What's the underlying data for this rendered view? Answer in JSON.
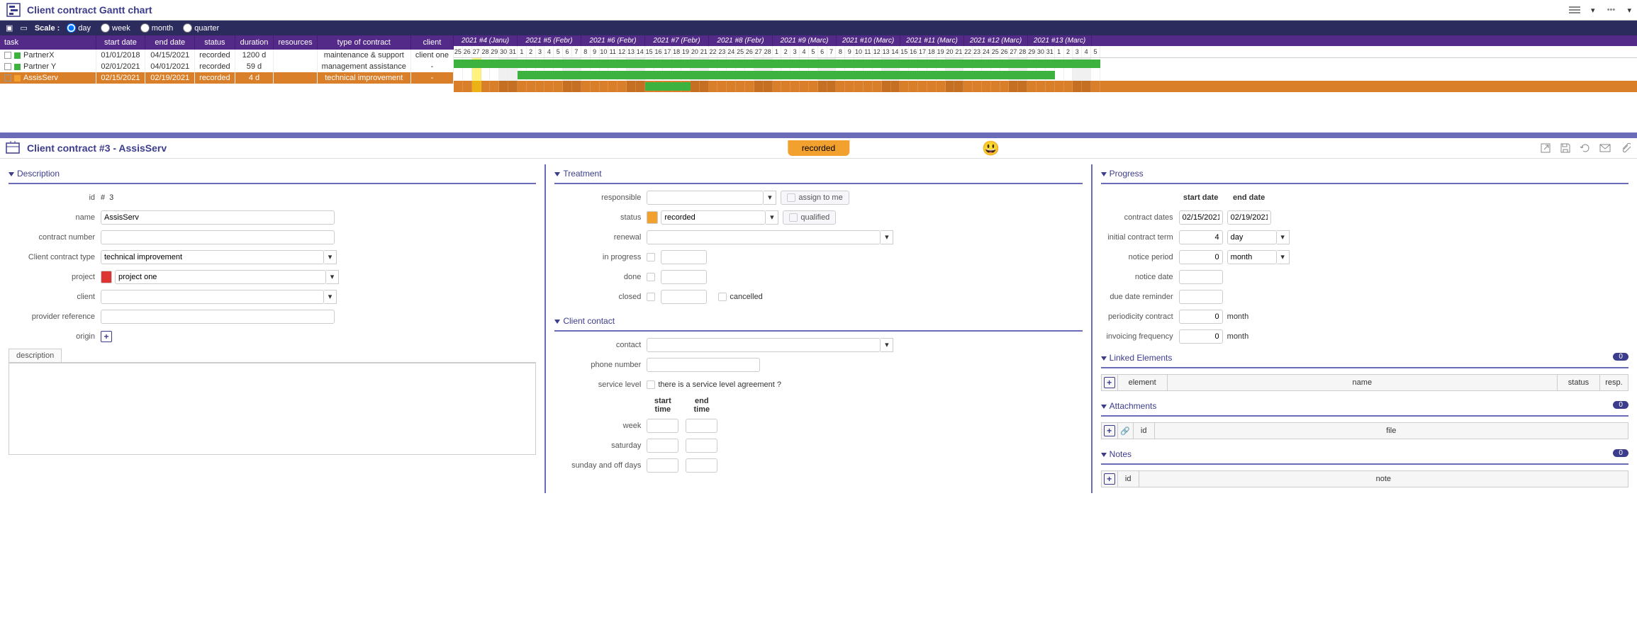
{
  "app": {
    "title": "Client contract Gantt chart"
  },
  "scale": {
    "label": "Scale :",
    "options": {
      "day": "day",
      "week": "week",
      "month": "month",
      "quarter": "quarter"
    },
    "selected": "day"
  },
  "grid": {
    "columns": {
      "task": "task",
      "start_date": "start date",
      "end_date": "end date",
      "status": "status",
      "duration": "duration",
      "resources": "resources",
      "type": "type of contract",
      "client": "client"
    },
    "rows": [
      {
        "task": "PartnerX",
        "start": "01/01/2018",
        "end": "04/15/2021",
        "status": "recorded",
        "duration": "1200 d",
        "resources": "",
        "type": "maintenance & support",
        "client": "client one",
        "color": "#3eb23e"
      },
      {
        "task": "Partner Y",
        "start": "02/01/2021",
        "end": "04/01/2021",
        "status": "recorded",
        "duration": "59 d",
        "resources": "",
        "type": "management assistance",
        "client": "-",
        "color": "#3eb23e"
      },
      {
        "task": "AssisServ",
        "start": "02/15/2021",
        "end": "02/19/2021",
        "status": "recorded",
        "duration": "4 d",
        "resources": "",
        "type": "technical improvement",
        "client": "-",
        "color": "#f2a02e",
        "selected": true
      }
    ]
  },
  "gantt": {
    "months": [
      "2021 #4 (Janu)",
      "2021 #5 (Febr)",
      "2021 #6 (Febr)",
      "2021 #7 (Febr)",
      "2021 #8 (Febr)",
      "2021 #9 (Marc)",
      "2021 #10 (Marc)",
      "2021 #11 (Marc)",
      "2021 #12 (Marc)",
      "2021 #13 (Marc)"
    ],
    "days": [
      25,
      26,
      27,
      28,
      29,
      30,
      31,
      1,
      2,
      3,
      4,
      5,
      6,
      7,
      8,
      9,
      10,
      11,
      12,
      13,
      14,
      15,
      16,
      17,
      18,
      19,
      20,
      21,
      22,
      23,
      24,
      25,
      26,
      27,
      28,
      1,
      2,
      3,
      4,
      5,
      6,
      7,
      8,
      9,
      10,
      11,
      12,
      13,
      14,
      15,
      16,
      17,
      18,
      19,
      20,
      21,
      22,
      23,
      24,
      25,
      26,
      27,
      28,
      29,
      30,
      31,
      1,
      2,
      3,
      4,
      5
    ]
  },
  "detail": {
    "title": "Client contract   #3  -  AssisServ",
    "status_pill": "recorded",
    "sections": {
      "description": "Description",
      "treatment": "Treatment",
      "client_contact": "Client contact",
      "progress": "Progress",
      "linked_elements": "Linked Elements",
      "attachments": "Attachments",
      "notes": "Notes"
    },
    "description": {
      "id_label": "id",
      "id_hash": "#",
      "id_value": "3",
      "name_label": "name",
      "name_value": "AssisServ",
      "contract_number_label": "contract number",
      "type_label": "Client contract type",
      "type_value": "technical improvement",
      "project_label": "project",
      "project_value": "project one",
      "client_label": "client",
      "provider_ref_label": "provider reference",
      "origin_label": "origin",
      "tab_description": "description"
    },
    "treatment": {
      "responsible_label": "responsible",
      "assign_to_me": "assign to me",
      "status_label": "status",
      "status_value": "recorded",
      "qualified": "qualified",
      "renewal_label": "renewal",
      "in_progress_label": "in progress",
      "done_label": "done",
      "closed_label": "closed",
      "cancelled_label": "cancelled"
    },
    "client_contact": {
      "contact_label": "contact",
      "phone_label": "phone number",
      "service_level_label": "service level",
      "sla_text": "there is a service level agreement ?",
      "start_time": "start time",
      "end_time": "end time",
      "week_label": "week",
      "saturday_label": "saturday",
      "sunday_label": "sunday and off days"
    },
    "progress": {
      "start_head": "start date",
      "end_head": "end date",
      "contract_dates_label": "contract dates",
      "start_value": "02/15/2021",
      "end_value": "02/19/2021",
      "initial_term_label": "initial contract term",
      "initial_term_value": "4",
      "initial_term_unit": "day",
      "notice_period_label": "notice period",
      "notice_period_value": "0",
      "notice_period_unit": "month",
      "notice_date_label": "notice date",
      "due_date_label": "due date reminder",
      "periodicity_label": "periodicity contract",
      "periodicity_value": "0",
      "periodicity_unit": "month",
      "invoicing_label": "invoicing frequency",
      "invoicing_value": "0",
      "invoicing_unit": "month"
    },
    "linked": {
      "count": "0",
      "cols": {
        "element": "element",
        "name": "name",
        "status": "status",
        "resp": "resp."
      }
    },
    "attachments": {
      "count": "0",
      "cols": {
        "id": "id",
        "file": "file"
      }
    },
    "notes": {
      "count": "0",
      "cols": {
        "id": "id",
        "note": "note"
      }
    }
  }
}
